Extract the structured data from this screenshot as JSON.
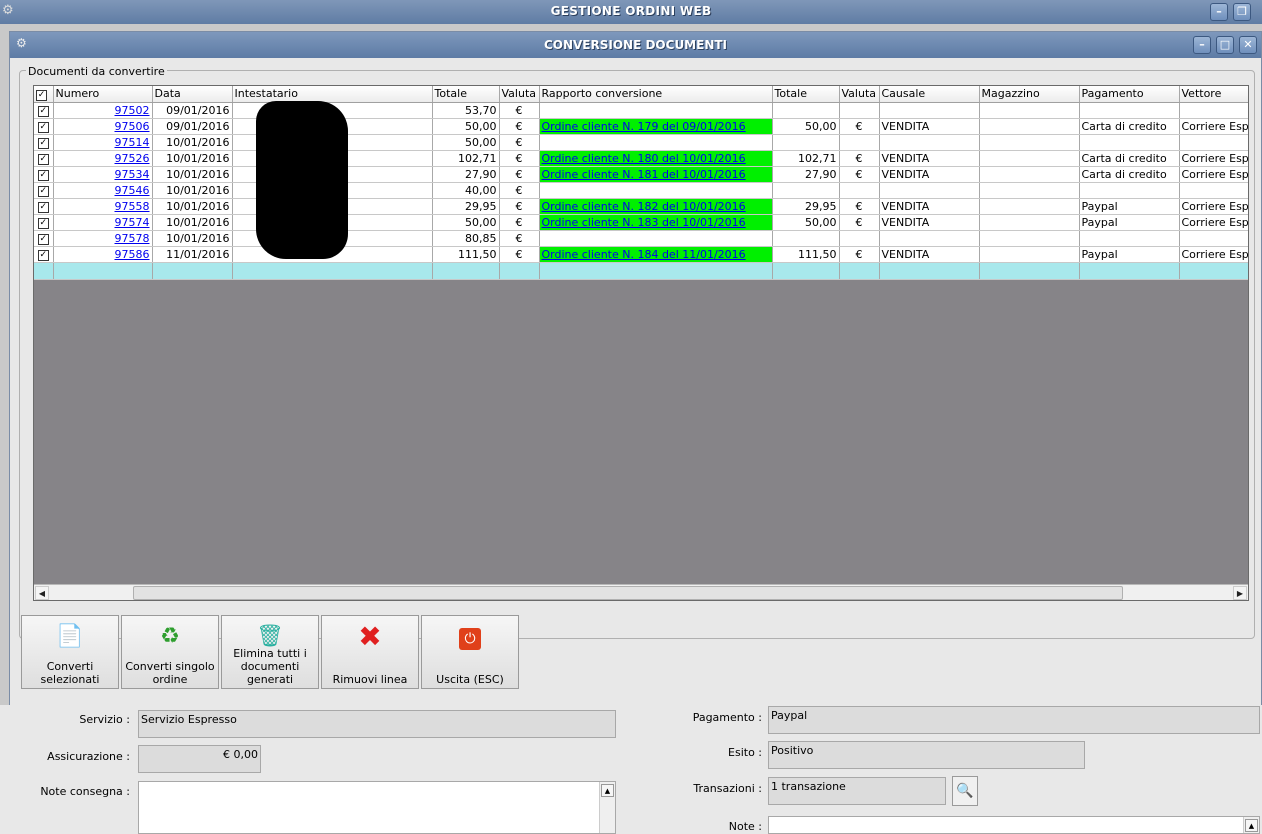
{
  "app": {
    "title": "GESTIONE ORDINI WEB"
  },
  "window": {
    "title": "CONVERSIONE DOCUMENTI"
  },
  "group": {
    "label": "Documenti da convertire"
  },
  "grid": {
    "columns": [
      "Numero",
      "Data",
      "Intestatario",
      "Totale",
      "Valuta",
      "Rapporto conversione",
      "Totale",
      "Valuta",
      "Causale",
      "Magazzino",
      "Pagamento",
      "Vettore"
    ],
    "rows": [
      {
        "numero": "97502",
        "data": "09/01/2016",
        "intestatario": "",
        "totale": "53,70",
        "valuta": "€",
        "rapporto": "",
        "totale2": "",
        "valuta2": "",
        "causale": "",
        "magazzino": "",
        "pagamento": "",
        "vettore": ""
      },
      {
        "numero": "97506",
        "data": "09/01/2016",
        "intestatario": "",
        "totale": "50,00",
        "valuta": "€",
        "rapporto": "Ordine cliente N. 179 del 09/01/2016",
        "totale2": "50,00",
        "valuta2": "€",
        "causale": "VENDITA",
        "magazzino": "",
        "pagamento": "Carta di credito",
        "vettore": "Corriere Espre"
      },
      {
        "numero": "97514",
        "data": "10/01/2016",
        "intestatario": "",
        "totale": "50,00",
        "valuta": "€",
        "rapporto": "",
        "totale2": "",
        "valuta2": "",
        "causale": "",
        "magazzino": "",
        "pagamento": "",
        "vettore": ""
      },
      {
        "numero": "97526",
        "data": "10/01/2016",
        "intestatario": "",
        "totale": "102,71",
        "valuta": "€",
        "rapporto": "Ordine cliente N. 180 del 10/01/2016",
        "totale2": "102,71",
        "valuta2": "€",
        "causale": "VENDITA",
        "magazzino": "",
        "pagamento": "Carta di credito",
        "vettore": "Corriere Espre"
      },
      {
        "numero": "97534",
        "data": "10/01/2016",
        "intestatario": "",
        "totale": "27,90",
        "valuta": "€",
        "rapporto": "Ordine cliente N. 181 del 10/01/2016",
        "totale2": "27,90",
        "valuta2": "€",
        "causale": "VENDITA",
        "magazzino": "",
        "pagamento": "Carta di credito",
        "vettore": "Corriere Espre"
      },
      {
        "numero": "97546",
        "data": "10/01/2016",
        "intestatario": "",
        "totale": "40,00",
        "valuta": "€",
        "rapporto": "",
        "totale2": "",
        "valuta2": "",
        "causale": "",
        "magazzino": "",
        "pagamento": "",
        "vettore": ""
      },
      {
        "numero": "97558",
        "data": "10/01/2016",
        "intestatario": "",
        "totale": "29,95",
        "valuta": "€",
        "rapporto": "Ordine cliente N. 182 del 10/01/2016",
        "totale2": "29,95",
        "valuta2": "€",
        "causale": "VENDITA",
        "magazzino": "",
        "pagamento": "Paypal",
        "vettore": "Corriere Espre"
      },
      {
        "numero": "97574",
        "data": "10/01/2016",
        "intestatario": "",
        "totale": "50,00",
        "valuta": "€",
        "rapporto": "Ordine cliente N. 183 del 10/01/2016",
        "totale2": "50,00",
        "valuta2": "€",
        "causale": "VENDITA",
        "magazzino": "",
        "pagamento": "Paypal",
        "vettore": "Corriere Espre"
      },
      {
        "numero": "97578",
        "data": "10/01/2016",
        "intestatario": "",
        "totale": "80,85",
        "valuta": "€",
        "rapporto": "",
        "totale2": "",
        "valuta2": "",
        "causale": "",
        "magazzino": "",
        "pagamento": "",
        "vettore": ""
      },
      {
        "numero": "97586",
        "data": "11/01/2016",
        "intestatario": "",
        "totale": "111,50",
        "valuta": "€",
        "rapporto": "Ordine cliente N. 184 del 11/01/2016",
        "totale2": "111,50",
        "valuta2": "€",
        "causale": "VENDITA",
        "magazzino": "",
        "pagamento": "Paypal",
        "vettore": "Corriere Espre"
      }
    ]
  },
  "toolbar": {
    "buttons": [
      {
        "label": "Converti selezionati",
        "icon": "document-gear-icon"
      },
      {
        "label": "Converti singolo ordine",
        "icon": "recycle-arrows-icon"
      },
      {
        "label": "Elimina tutti i documenti generati",
        "icon": "trash-bin-icon"
      },
      {
        "label": "Rimuovi linea",
        "icon": "red-x-icon"
      },
      {
        "label": "Uscita (ESC)",
        "icon": "power-icon"
      }
    ]
  },
  "form": {
    "servizio_label": "Servizio :",
    "servizio_value": "Servizio Espresso",
    "assicurazione_label": "Assicurazione :",
    "assicurazione_value": "€ 0,00",
    "note_consegna_label": "Note consegna :",
    "note_consegna_value": "",
    "pagamento_label": "Pagamento :",
    "pagamento_value": "Paypal",
    "esito_label": "Esito :",
    "esito_value": "Positivo",
    "transazioni_label": "Transazioni :",
    "transazioni_value": "1 transazione",
    "note_label": "Note :",
    "note_value": ""
  }
}
